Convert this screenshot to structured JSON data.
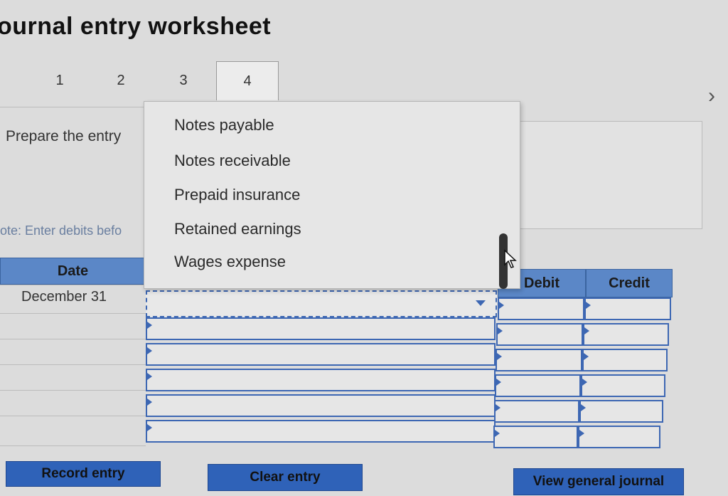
{
  "page": {
    "title": "ournal entry worksheet"
  },
  "tabs": [
    {
      "label": "1",
      "active": false
    },
    {
      "label": "2",
      "active": false
    },
    {
      "label": "3",
      "active": false
    },
    {
      "label": "4",
      "active": true
    }
  ],
  "nav": {
    "next_icon": "chevron-right-icon"
  },
  "instruction": {
    "text": "Prepare the entry"
  },
  "note": {
    "text": "lote: Enter debits befo"
  },
  "table": {
    "headers": {
      "date": "Date",
      "debit": "Debit",
      "credit": "Credit"
    },
    "rows": [
      {
        "date": "December 31",
        "account": "",
        "debit": "",
        "credit": ""
      },
      {
        "date": "",
        "account": "",
        "debit": "",
        "credit": ""
      },
      {
        "date": "",
        "account": "",
        "debit": "",
        "credit": ""
      },
      {
        "date": "",
        "account": "",
        "debit": "",
        "credit": ""
      },
      {
        "date": "",
        "account": "",
        "debit": "",
        "credit": ""
      },
      {
        "date": "",
        "account": "",
        "debit": "",
        "credit": ""
      }
    ]
  },
  "account_dropdown": {
    "options": [
      "Notes payable",
      "Notes receivable",
      "Prepaid insurance",
      "Retained earnings",
      "Wages expense"
    ]
  },
  "buttons": {
    "record": "Record entry",
    "clear": "Clear entry",
    "view_journal": "View general journal"
  },
  "colors": {
    "header_blue": "#5b87c7",
    "button_blue": "#2f62b8",
    "border_blue": "#3d67b3"
  }
}
